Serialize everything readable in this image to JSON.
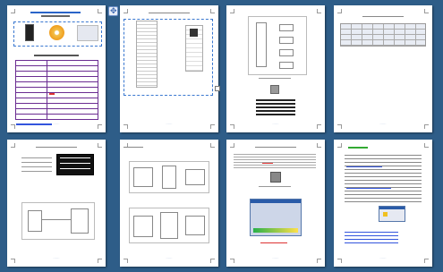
{
  "document": {
    "view": "multi-page thumbnail view",
    "pages": [
      {
        "index": 1,
        "content": "datasheet cover with images and table",
        "footer": "............"
      },
      {
        "index": 2,
        "content": "pinout figure",
        "footer": "............"
      },
      {
        "index": 3,
        "content": "block diagram and small table",
        "footer": "............"
      },
      {
        "index": 4,
        "content": "grid table",
        "footer": "............"
      },
      {
        "index": 5,
        "content": "schematic diagrams",
        "footer": "............"
      },
      {
        "index": 6,
        "content": "connection diagrams",
        "footer": "............"
      },
      {
        "index": 7,
        "content": "text with images and software window",
        "footer": "............"
      },
      {
        "index": 8,
        "content": "text list with dialog",
        "footer": "............"
      }
    ],
    "colors": {
      "background": "#2e5d88",
      "selection": "#3a78d0",
      "purple_table": "#6a2c91",
      "orange_disc": "#f0a020",
      "link_blue": "#3355dd"
    },
    "icons": [
      "move-handle-icon",
      "resize-handle-icon"
    ]
  }
}
